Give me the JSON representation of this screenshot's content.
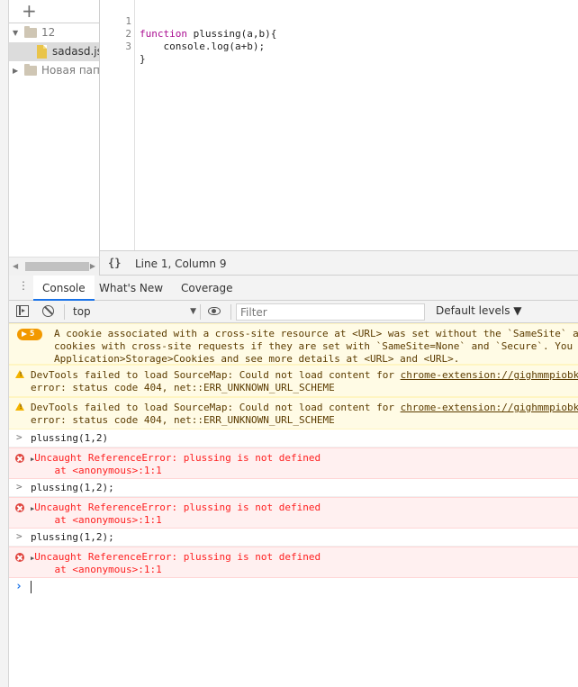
{
  "navigator": {
    "add_label": "+",
    "tree": [
      {
        "label": "12",
        "type": "folder",
        "expanded": true
      },
      {
        "label": "sadasd.js",
        "type": "file",
        "selected": true
      },
      {
        "label": "Новая папка",
        "type": "folder",
        "expanded": false
      }
    ]
  },
  "editor": {
    "lines": [
      {
        "num": "1",
        "code": "function plussing(a,b){"
      },
      {
        "num": "2",
        "code": "    console.log(a+b);"
      },
      {
        "num": "3",
        "code": "}"
      }
    ],
    "status_icon": "{}",
    "cursor_position": "Line 1, Column 9"
  },
  "drawer": {
    "tabs": [
      {
        "label": "Console",
        "active": true
      },
      {
        "label": "What's New",
        "active": false
      },
      {
        "label": "Coverage",
        "active": false
      }
    ]
  },
  "console_toolbar": {
    "context": "top",
    "filter_placeholder": "Filter",
    "levels": "Default levels ▼"
  },
  "messages": {
    "cookie_count": "5",
    "cookie_text": "A cookie associated with a cross-site resource at <URL> was set without the `SameSite` at\ncookies with cross-site requests if they are set with `SameSite=None` and `Secure`. You\nApplication>Storage>Cookies and see more details at <URL> and <URL>.",
    "sourcemap_1_a": "DevTools failed to load SourceMap: Could not load content for ",
    "sourcemap_1_link": "chrome-extension://gighmmpiobk",
    "sourcemap_1_b": "error: status code 404, net::ERR_UNKNOWN_URL_SCHEME",
    "sourcemap_2_a": "DevTools failed to load SourceMap: Could not load content for ",
    "sourcemap_2_link": "chrome-extension://gighmmpiobk",
    "sourcemap_2_b": "error: status code 404, net::ERR_UNKNOWN_URL_SCHEME",
    "input_1": "plussing(1,2)",
    "error_1_a": "Uncaught ReferenceError: plussing is not defined",
    "error_1_b": "    at <anonymous>:1:1",
    "input_2": "plussing(1,2);",
    "error_2_a": "Uncaught ReferenceError: plussing is not defined",
    "error_2_b": "    at <anonymous>:1:1",
    "input_3": "plussing(1,2);",
    "error_3_a": "Uncaught ReferenceError: plussing is not defined",
    "error_3_b": "    at <anonymous>:1:1"
  },
  "colors": {
    "accent": "#1a73e8",
    "warning_bg": "#fffbe5",
    "error_bg": "#fff0f0",
    "error_text": "#fe2020"
  }
}
